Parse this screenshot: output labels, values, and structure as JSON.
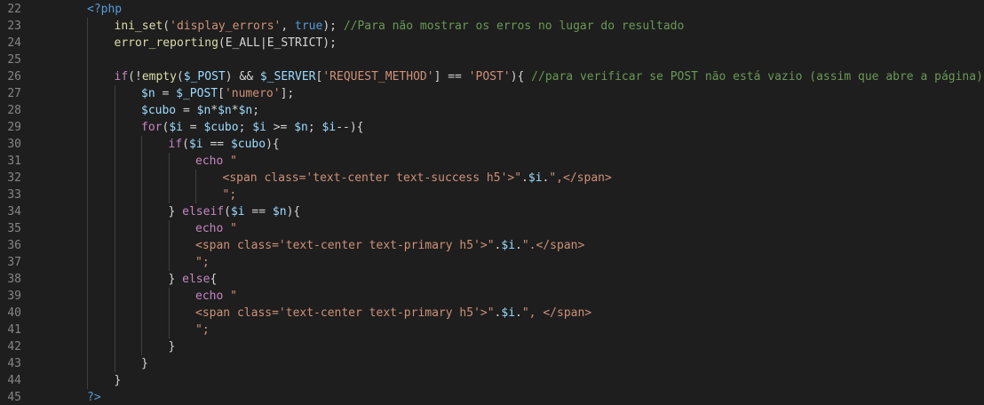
{
  "editor": {
    "colors": {
      "background": "#1e1e1e",
      "line_number": "#858585",
      "keyword": "#569cd6",
      "control": "#c586c0",
      "function": "#dcdcaa",
      "string": "#ce9178",
      "variable": "#9cdcfe",
      "comment": "#6a9955",
      "text": "#d4d4d4"
    },
    "lines": [
      {
        "num": "22",
        "indent": 0,
        "tokens": [
          [
            "kw",
            "<?php"
          ]
        ]
      },
      {
        "num": "23",
        "indent": 1,
        "tokens": [
          [
            "fn",
            "ini_set"
          ],
          [
            "txt",
            "("
          ],
          [
            "str",
            "'display_errors'"
          ],
          [
            "txt",
            ", "
          ],
          [
            "kw",
            "true"
          ],
          [
            "txt",
            "); "
          ],
          [
            "cmt",
            "//Para não mostrar os erros no lugar do resultado"
          ]
        ]
      },
      {
        "num": "24",
        "indent": 1,
        "tokens": [
          [
            "fn",
            "error_reporting"
          ],
          [
            "txt",
            "(E_ALL|E_STRICT);"
          ]
        ]
      },
      {
        "num": "25",
        "indent": 1,
        "tokens": []
      },
      {
        "num": "26",
        "indent": 1,
        "tokens": [
          [
            "ctl",
            "if"
          ],
          [
            "txt",
            "(!"
          ],
          [
            "fn",
            "empty"
          ],
          [
            "txt",
            "("
          ],
          [
            "var",
            "$_POST"
          ],
          [
            "txt",
            ") && "
          ],
          [
            "var",
            "$_SERVER"
          ],
          [
            "txt",
            "["
          ],
          [
            "str",
            "'REQUEST_METHOD'"
          ],
          [
            "txt",
            "] == "
          ],
          [
            "str",
            "'POST'"
          ],
          [
            "txt",
            "){ "
          ],
          [
            "cmt",
            "//para verificar se POST não está vazio (assim que abre a página)"
          ]
        ]
      },
      {
        "num": "27",
        "indent": 2,
        "tokens": [
          [
            "var",
            "$n"
          ],
          [
            "txt",
            " = "
          ],
          [
            "var",
            "$_POST"
          ],
          [
            "txt",
            "["
          ],
          [
            "str",
            "'numero'"
          ],
          [
            "txt",
            "];"
          ]
        ]
      },
      {
        "num": "28",
        "indent": 2,
        "tokens": [
          [
            "var",
            "$cubo"
          ],
          [
            "txt",
            " = "
          ],
          [
            "var",
            "$n"
          ],
          [
            "txt",
            "*"
          ],
          [
            "var",
            "$n"
          ],
          [
            "txt",
            "*"
          ],
          [
            "var",
            "$n"
          ],
          [
            "txt",
            ";"
          ]
        ]
      },
      {
        "num": "29",
        "indent": 2,
        "tokens": [
          [
            "ctl",
            "for"
          ],
          [
            "txt",
            "("
          ],
          [
            "var",
            "$i"
          ],
          [
            "txt",
            " = "
          ],
          [
            "var",
            "$cubo"
          ],
          [
            "txt",
            "; "
          ],
          [
            "var",
            "$i"
          ],
          [
            "txt",
            " >= "
          ],
          [
            "var",
            "$n"
          ],
          [
            "txt",
            "; "
          ],
          [
            "var",
            "$i"
          ],
          [
            "txt",
            "--){"
          ]
        ]
      },
      {
        "num": "30",
        "indent": 3,
        "tokens": [
          [
            "ctl",
            "if"
          ],
          [
            "txt",
            "("
          ],
          [
            "var",
            "$i"
          ],
          [
            "txt",
            " == "
          ],
          [
            "var",
            "$cubo"
          ],
          [
            "txt",
            "){"
          ]
        ]
      },
      {
        "num": "31",
        "indent": 4,
        "tokens": [
          [
            "ctl",
            "echo"
          ],
          [
            "txt",
            " "
          ],
          [
            "str",
            "\""
          ]
        ]
      },
      {
        "num": "32",
        "indent": 5,
        "tokens": [
          [
            "str",
            "<span class='text-center text-success h5'>\""
          ],
          [
            "txt",
            "."
          ],
          [
            "var",
            "$i"
          ],
          [
            "txt",
            "."
          ],
          [
            "str",
            "\",</span>"
          ]
        ]
      },
      {
        "num": "33",
        "indent": 5,
        "tokens": [
          [
            "str",
            "\";"
          ]
        ]
      },
      {
        "num": "34",
        "indent": 3,
        "tokens": [
          [
            "txt",
            "} "
          ],
          [
            "ctl",
            "elseif"
          ],
          [
            "txt",
            "("
          ],
          [
            "var",
            "$i"
          ],
          [
            "txt",
            " == "
          ],
          [
            "var",
            "$n"
          ],
          [
            "txt",
            "){"
          ]
        ]
      },
      {
        "num": "35",
        "indent": 4,
        "tokens": [
          [
            "ctl",
            "echo"
          ],
          [
            "txt",
            " "
          ],
          [
            "str",
            "\""
          ]
        ]
      },
      {
        "num": "36",
        "indent": 4,
        "tokens": [
          [
            "str",
            "<span class='text-center text-primary h5'>\""
          ],
          [
            "txt",
            "."
          ],
          [
            "var",
            "$i"
          ],
          [
            "txt",
            "."
          ],
          [
            "str",
            "\".</span>"
          ]
        ]
      },
      {
        "num": "37",
        "indent": 4,
        "tokens": [
          [
            "str",
            "\";"
          ]
        ]
      },
      {
        "num": "38",
        "indent": 3,
        "tokens": [
          [
            "txt",
            "} "
          ],
          [
            "ctl",
            "else"
          ],
          [
            "txt",
            "{"
          ]
        ]
      },
      {
        "num": "39",
        "indent": 4,
        "tokens": [
          [
            "ctl",
            "echo"
          ],
          [
            "txt",
            " "
          ],
          [
            "str",
            "\""
          ]
        ]
      },
      {
        "num": "40",
        "indent": 4,
        "tokens": [
          [
            "str",
            "<span class='text-center text-primary h5'>\""
          ],
          [
            "txt",
            "."
          ],
          [
            "var",
            "$i"
          ],
          [
            "txt",
            "."
          ],
          [
            "str",
            "\", </span>"
          ]
        ]
      },
      {
        "num": "41",
        "indent": 4,
        "tokens": [
          [
            "str",
            "\";"
          ]
        ]
      },
      {
        "num": "42",
        "indent": 3,
        "tokens": [
          [
            "txt",
            "}"
          ]
        ]
      },
      {
        "num": "43",
        "indent": 2,
        "tokens": [
          [
            "txt",
            "}"
          ]
        ]
      },
      {
        "num": "44",
        "indent": 1,
        "tokens": [
          [
            "txt",
            "}"
          ]
        ]
      },
      {
        "num": "45",
        "indent": 0,
        "tokens": [
          [
            "kw",
            "?>"
          ]
        ]
      }
    ]
  }
}
